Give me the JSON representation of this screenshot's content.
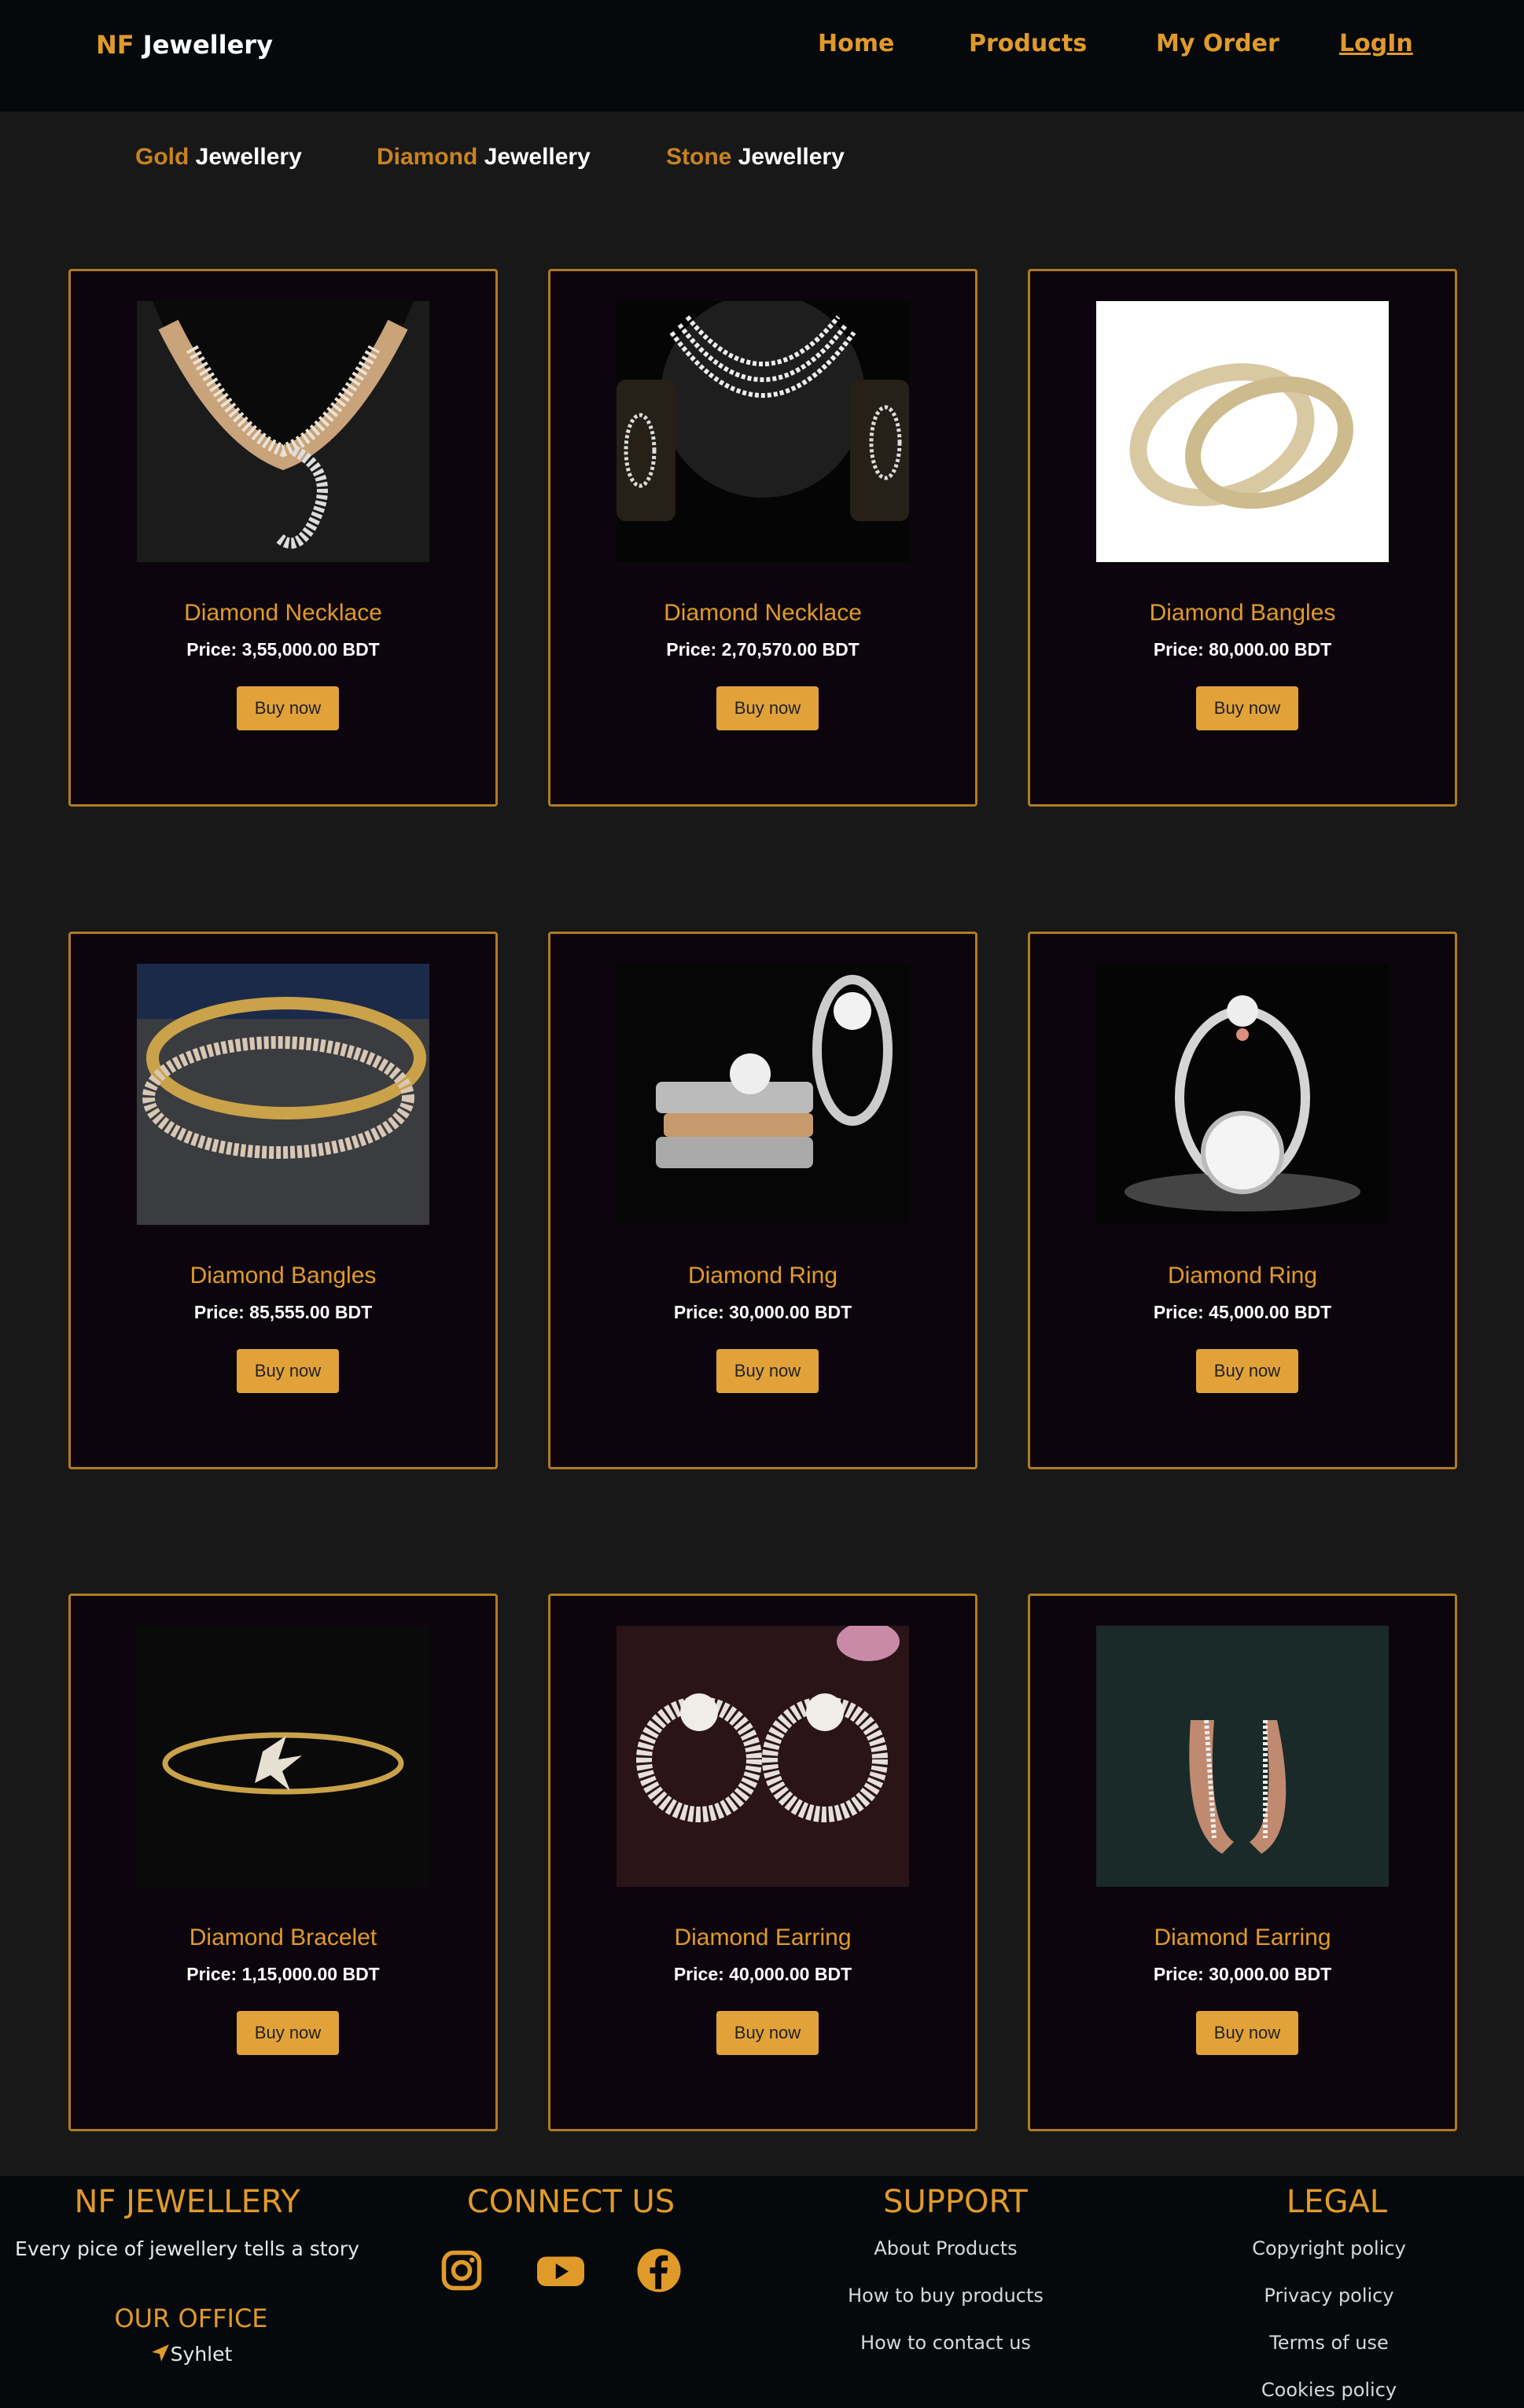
{
  "header": {
    "brand_accent": "NF",
    "brand_rest": "Jewellery",
    "nav": [
      "Home",
      "Products",
      "My Order",
      "LogIn"
    ]
  },
  "categories": [
    {
      "accent": "Gold",
      "rest": "Jewellery"
    },
    {
      "accent": "Diamond",
      "rest": "Jewellery"
    },
    {
      "accent": "Stone",
      "rest": "Jewellery"
    }
  ],
  "products": [
    {
      "name": "Diamond Necklace",
      "price": "Price: 3,55,000.00 BDT",
      "button": "Buy now"
    },
    {
      "name": "Diamond Necklace",
      "price": "Price: 2,70,570.00 BDT",
      "button": "Buy now"
    },
    {
      "name": "Diamond Bangles",
      "price": "Price: 80,000.00 BDT",
      "button": "Buy now"
    },
    {
      "name": "Diamond Bangles",
      "price": "Price: 85,555.00 BDT",
      "button": "Buy now"
    },
    {
      "name": "Diamond Ring",
      "price": "Price: 30,000.00 BDT",
      "button": "Buy now"
    },
    {
      "name": "Diamond Ring",
      "price": "Price: 45,000.00 BDT",
      "button": "Buy now"
    },
    {
      "name": "Diamond Bracelet",
      "price": "Price: 1,15,000.00 BDT",
      "button": "Buy now"
    },
    {
      "name": "Diamond Earring",
      "price": "Price: 40,000.00 BDT",
      "button": "Buy now"
    },
    {
      "name": "Diamond Earring",
      "price": "Price: 30,000.00 BDT",
      "button": "Buy now"
    }
  ],
  "footer": {
    "brand": "NF JEWELLERY",
    "tagline": "Every pice of jewellery tells a story",
    "office_title": "OUR OFFICE",
    "office_city": "Syhlet",
    "connect_title": "CONNECT US",
    "social_icons": [
      "instagram-icon",
      "youtube-icon",
      "facebook-icon"
    ],
    "support_title": "SUPPORT",
    "support_links": [
      "About Products",
      "How to buy products",
      "How to contact us"
    ],
    "legal_title": "LEGAL",
    "legal_links": [
      "Copyright policy",
      "Privacy policy",
      "Terms of use",
      "Cookies policy"
    ]
  },
  "colors": {
    "accent": "#e09a2a",
    "button": "#e1a23a",
    "card_border": "#b07a22",
    "page_bg": "#181818",
    "card_bg": "#0d050d"
  }
}
